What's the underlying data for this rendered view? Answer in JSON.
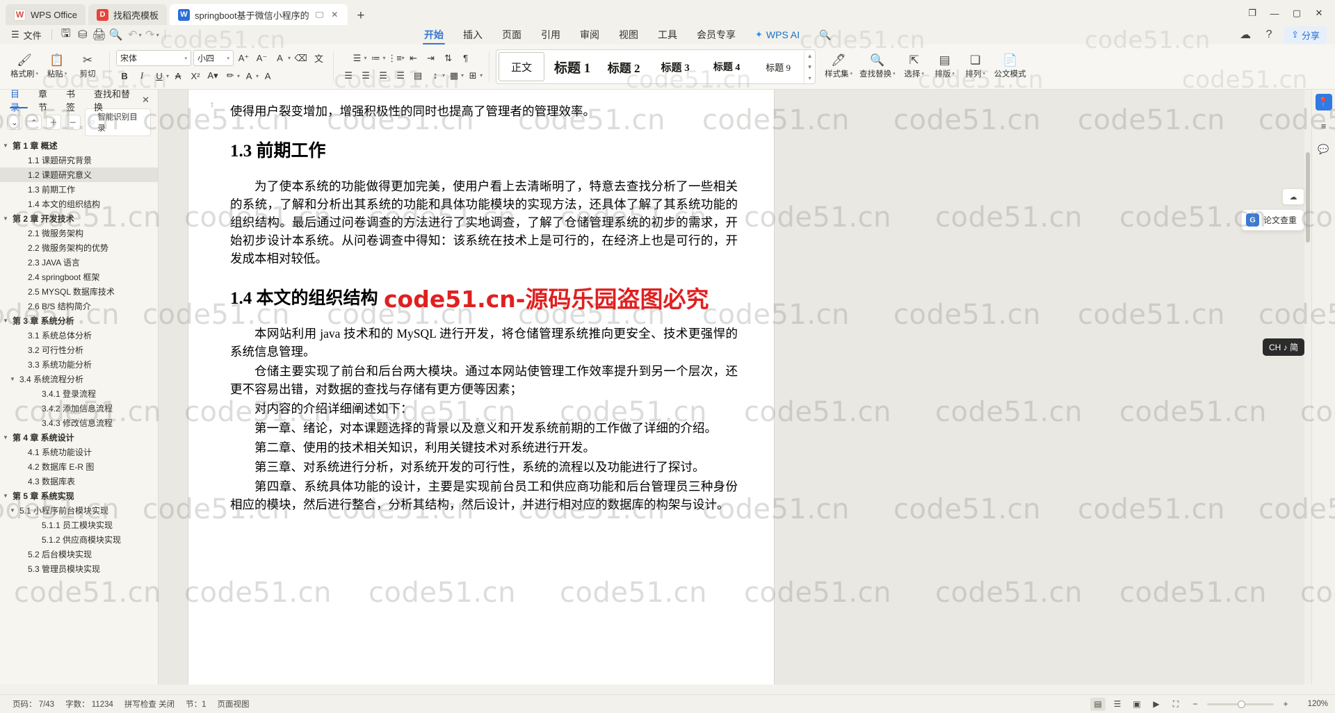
{
  "window": {
    "tabs": [
      {
        "label": "WPS Office",
        "icon": "wps-logo-icon",
        "kind": "app"
      },
      {
        "label": "找稻壳模板",
        "icon": "template-icon",
        "kind": "template"
      },
      {
        "label": "springboot基于微信小程序的",
        "icon": "word-doc-icon",
        "kind": "doc",
        "active": true
      }
    ],
    "add_tab": "+",
    "controls": {
      "restore_layout": "❐",
      "minimize": "—",
      "maximize": "▢",
      "close": "✕"
    }
  },
  "quickbar": {
    "menu_icon": "hamburger-icon",
    "file_label": "文件",
    "icons": [
      "save-icon",
      "save-as-cloud-icon",
      "print-icon",
      "print-preview-icon",
      "undo-icon",
      "undo-dropdown-icon",
      "redo-icon",
      "customize-dropdown-icon"
    ],
    "share_label": "分享",
    "cloud_icon": "cloud-sync-icon",
    "help_icon": "help-icon"
  },
  "menu": {
    "items": [
      "开始",
      "插入",
      "页面",
      "引用",
      "审阅",
      "视图",
      "工具",
      "会员专享"
    ],
    "active": "开始",
    "ai_label": "WPS AI",
    "search_icon": "search-icon"
  },
  "ribbon": {
    "format_painter": "格式刷",
    "paste": "粘贴",
    "cut": "剪切",
    "font_name": "宋体",
    "font_size": "小四",
    "grow_font": "A⁺",
    "shrink_font": "A⁻",
    "text_effects": "文字效果",
    "clear_format": "清除格式",
    "pinyin": "拼音指南",
    "bold": "B",
    "italic": "I",
    "underline": "U",
    "strikethrough": "abc",
    "superscript": "X²",
    "subscript": "X₂",
    "highlight": "highlight-icon",
    "font_color": "font-color-icon",
    "character_border": "A",
    "bullets": "bullets-icon",
    "numbering": "numbering-icon",
    "multilevel": "multilevel-list-icon",
    "decrease_indent": "decrease-indent-icon",
    "increase_indent": "increase-indent-icon",
    "sort": "sort-icon",
    "show_marks": "show-marks-icon",
    "align_left": "align-left-icon",
    "align_center": "align-center-icon",
    "align_right": "align-right-icon",
    "align_justify": "align-justify-icon",
    "distribute": "distribute-icon",
    "line_spacing": "line-spacing-icon",
    "shading": "shading-icon",
    "borders": "borders-icon",
    "styles": [
      "正文",
      "标题 1",
      "标题 2",
      "标题 3",
      "标题 4",
      "标题 9"
    ],
    "style_selected": "正文",
    "style_set": "样式集",
    "find_replace": "查找替换",
    "select": "选择",
    "typeset": "排版",
    "arrange": "排列",
    "doc_mode": "公文模式"
  },
  "sidebar": {
    "tabs": [
      "目录",
      "章节",
      "书签",
      "查找和替换"
    ],
    "active_tab": "目录",
    "close_icon": "close-icon",
    "tools": [
      "expand-down-icon",
      "collapse-up-icon",
      "increase-level-icon",
      "decrease-level-icon"
    ],
    "smart_label": "智能识别目录",
    "smart_icon": "smart-toc-icon",
    "toc": [
      {
        "label": "第 1 章 概述",
        "level": 1,
        "expanded": true
      },
      {
        "label": "1.1 课题研究背景",
        "level": 2
      },
      {
        "label": "1.2 课题研究意义",
        "level": 2,
        "selected": true
      },
      {
        "label": "1.3 前期工作",
        "level": 2
      },
      {
        "label": "1.4 本文的组织结构",
        "level": 2
      },
      {
        "label": "第 2 章 开发技术",
        "level": 1,
        "expanded": true
      },
      {
        "label": "2.1 微服务架构",
        "level": 2
      },
      {
        "label": "2.2 微服务架构的优势",
        "level": 2
      },
      {
        "label": "2.3 JAVA 语言",
        "level": 2
      },
      {
        "label": "2.4 springboot 框架",
        "level": 2
      },
      {
        "label": "2.5 MYSQL 数据库技术",
        "level": 2
      },
      {
        "label": "2.6 B/S 结构简介",
        "level": 2
      },
      {
        "label": "第 3 章 系统分析",
        "level": 1,
        "expanded": true
      },
      {
        "label": "3.1 系统总体分析",
        "level": 2
      },
      {
        "label": "3.2 可行性分析",
        "level": 2
      },
      {
        "label": "3.3 系统功能分析",
        "level": 2
      },
      {
        "label": "3.4 系统流程分析",
        "level": 2,
        "expanded": true
      },
      {
        "label": "3.4.1 登录流程",
        "level": 3
      },
      {
        "label": "3.4.2 添加信息流程",
        "level": 3
      },
      {
        "label": "3.4.3 修改信息流程",
        "level": 3
      },
      {
        "label": "第 4 章 系统设计",
        "level": 1,
        "expanded": true
      },
      {
        "label": "4.1 系统功能设计",
        "level": 2
      },
      {
        "label": "4.2 数据库 E-R 图",
        "level": 2
      },
      {
        "label": "4.3 数据库表",
        "level": 2
      },
      {
        "label": "第 5 章 系统实现",
        "level": 1,
        "expanded": true
      },
      {
        "label": "5.1 小程序前台模块实现",
        "level": 2,
        "expanded": true
      },
      {
        "label": "5.1.1 员工模块实现",
        "level": 3
      },
      {
        "label": "5.1.2 供应商模块实现",
        "level": 3
      },
      {
        "label": "5.2 后台模块实现",
        "level": 2
      },
      {
        "label": "5.3 管理员模块实现",
        "level": 2
      }
    ]
  },
  "document": {
    "blocks": [
      {
        "type": "para",
        "text": "使得用户裂变增加，增强积极性的同时也提高了管理者的管理效率。"
      },
      {
        "type": "heading",
        "text": "1.3 前期工作"
      },
      {
        "type": "para_indent",
        "text": "为了使本系统的功能做得更加完美，使用户看上去清晰明了，特意去查找分析了一些相关的系统，了解和分析出其系统的功能和具体功能模块的实现方法，还具体了解了其系统功能的组织结构。最后通过问卷调查的方法进行了实地调查，了解了仓储管理系统的初步的需求，开始初步设计本系统。从问卷调查中得知：该系统在技术上是可行的，在经济上也是可行的，开发成本相对较低。"
      },
      {
        "type": "heading",
        "text": "1.4 本文的组织结构"
      },
      {
        "type": "para_indent",
        "text": "本网站利用 java 技术和的 MySQL 进行开发，将仓储管理系统推向更安全、技术更强悍的系统信息管理。"
      },
      {
        "type": "para_indent",
        "text": "仓储主要实现了前台和后台两大模块。通过本网站使管理工作效率提升到另一个层次，还更不容易出错，对数据的查找与存储有更方便等因素；"
      },
      {
        "type": "para_indent",
        "text": "对内容的介绍详细阐述如下："
      },
      {
        "type": "para_indent",
        "text": "第一章、绪论，对本课题选择的背景以及意义和开发系统前期的工作做了详细的介绍。"
      },
      {
        "type": "para_indent",
        "text": "第二章、使用的技术相关知识，利用关键技术对系统进行开发。"
      },
      {
        "type": "para_indent",
        "text": "第三章、对系统进行分析，对系统开发的可行性，系统的流程以及功能进行了探讨。"
      },
      {
        "type": "para_indent",
        "text": "第四章、系统具体功能的设计，主要是实现前台员工和供应商功能和后台管理员三种身份相应的模块，然后进行整合，分析其结构，然后设计，并进行相对应的数据库的构架与设计。"
      }
    ]
  },
  "watermarks": {
    "tile_text": "code51.cn",
    "red_text": "code51.cn-源码乐园盗图必究",
    "red_color": "#e02020"
  },
  "right_rail": {
    "icons": [
      "location-pin-icon",
      "list-panel-icon",
      "comment-icon"
    ],
    "float_tool": "page-up-icon",
    "checker": {
      "label": "论文查重",
      "badge": "G"
    },
    "ime": {
      "label": "CH ♪ 简"
    }
  },
  "statusbar": {
    "page_info": "页码： 7/43",
    "word_count": "字数： 11234",
    "spell": "拼写检查 关闭",
    "section": "节：1",
    "mode": "页面视图",
    "view_icons": [
      "page-view-icon",
      "outline-view-icon",
      "web-view-icon",
      "read-view-icon",
      "fullscreen-icon"
    ],
    "zoom_out": "−",
    "zoom_in": "+",
    "zoom_level": "120%"
  }
}
